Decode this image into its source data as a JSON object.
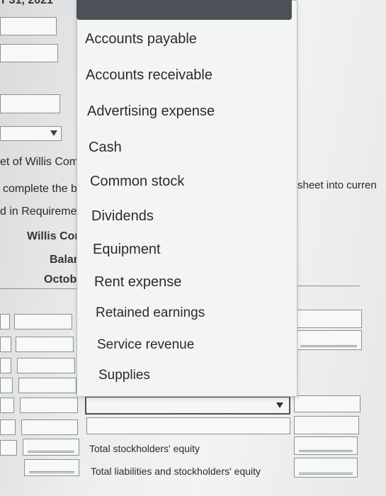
{
  "header": {
    "title_fragment": "r 31, 2021"
  },
  "left_panel": {
    "line1": "et of Willis Com",
    "line2": "complete the b",
    "line3": "d in Requireme",
    "company": "Willis Cor",
    "statement": "Balan",
    "date": "Octobe"
  },
  "right_panel": {
    "text": "sheet into curren"
  },
  "dropdown": {
    "options": [
      "Accounts payable",
      "Accounts receivable",
      "Advertising expense",
      "Cash",
      "Common stock",
      "Dividends",
      "Equipment",
      "Rent expense",
      "Retained earnings",
      "Service revenue",
      "Supplies"
    ]
  },
  "rows": {
    "total_equity": "Total stockholders' equity",
    "total_liab_equity": "Total liabilities and stockholders' equity"
  }
}
